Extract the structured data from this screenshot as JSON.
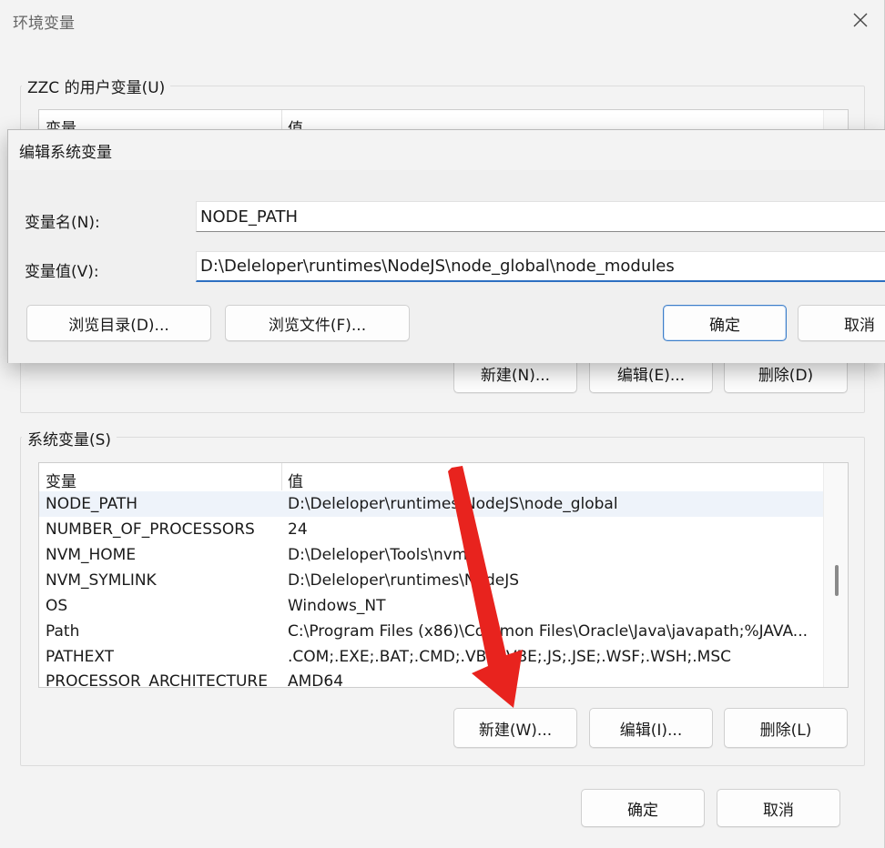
{
  "main_window": {
    "title": "环境变量",
    "close_icon": "close-icon"
  },
  "user_vars": {
    "group_label": "ZZC 的用户变量(U)",
    "col_name": "变量",
    "col_value": "值",
    "new_label": "新建(N)...",
    "edit_label": "编辑(E)...",
    "delete_label": "删除(D)"
  },
  "system_vars": {
    "group_label": "系统变量(S)",
    "col_name": "变量",
    "col_value": "值",
    "rows": [
      {
        "name": "NODE_PATH",
        "value": "D:\\Deleloper\\runtimes\\NodeJS\\node_global"
      },
      {
        "name": "NUMBER_OF_PROCESSORS",
        "value": "24"
      },
      {
        "name": "NVM_HOME",
        "value": "D:\\Deleloper\\Tools\\nvm"
      },
      {
        "name": "NVM_SYMLINK",
        "value": "D:\\Deleloper\\runtimes\\NodeJS"
      },
      {
        "name": "OS",
        "value": "Windows_NT"
      },
      {
        "name": "Path",
        "value": "C:\\Program Files (x86)\\Common Files\\Oracle\\Java\\javapath;%JAVA..."
      },
      {
        "name": "PATHEXT",
        "value": ".COM;.EXE;.BAT;.CMD;.VBS;.VBE;.JS;.JSE;.WSF;.WSH;.MSC"
      },
      {
        "name": "PROCESSOR_ARCHITECTURE",
        "value": "AMD64"
      }
    ],
    "new_label": "新建(W)...",
    "edit_label": "编辑(I)...",
    "delete_label": "删除(L)"
  },
  "footer": {
    "ok_label": "确定",
    "cancel_label": "取消"
  },
  "edit_dialog": {
    "title": "编辑系统变量",
    "name_label": "变量名(N):",
    "value_label": "变量值(V):",
    "name_value": "NODE_PATH",
    "value_value": "D:\\Deleloper\\runtimes\\NodeJS\\node_global\\node_modules",
    "browse_dir_label": "浏览目录(D)...",
    "browse_file_label": "浏览文件(F)...",
    "ok_label": "确定",
    "cancel_label": "取消"
  },
  "colors": {
    "annotation_arrow": "#e8231e",
    "focus_blue": "#2d6fc1",
    "row_highlight": "#eef3fa"
  }
}
